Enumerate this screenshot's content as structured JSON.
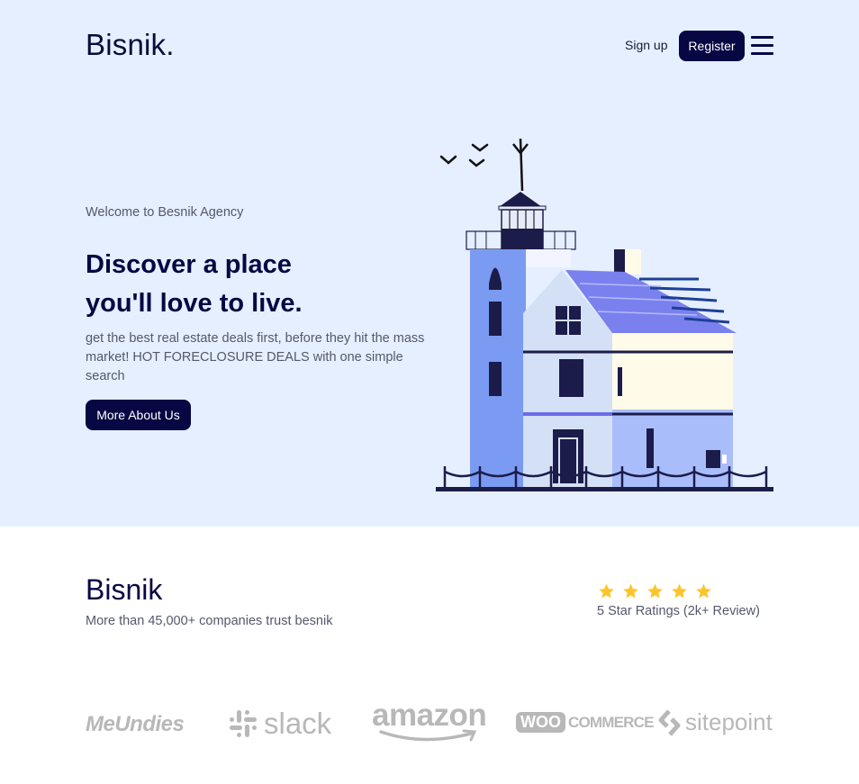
{
  "header": {
    "logo": "Bisnik.",
    "signup_label": "Sign up",
    "register_label": "Register"
  },
  "hero": {
    "welcome": "Welcome to Besnik Agency",
    "headline_line1": "Discover a place",
    "headline_line2": "you'll love to live.",
    "description": "get the best real estate deals first, before they hit the mass market! HOT FORECLOSURE DEALS with one simple search",
    "cta_label": "More About Us"
  },
  "trust": {
    "title": "Bisnik",
    "subtitle": "More than 45,000+ companies trust besnik",
    "stars": 5,
    "rating_text": "5 Star Ratings (2k+ Review)"
  },
  "partners": [
    {
      "name": "MeUndies",
      "icon": "meundies-logo"
    },
    {
      "name": "slack",
      "icon": "slack-logo"
    },
    {
      "name": "amazon",
      "icon": "amazon-logo"
    },
    {
      "name": "COMMERCE",
      "prefix": "WOO",
      "icon": "woocommerce-logo"
    },
    {
      "name": "sitepoint",
      "icon": "sitepoint-logo"
    }
  ],
  "colors": {
    "hero_bg": "#e5efff",
    "primary": "#070744",
    "star": "#fdc52c",
    "partner_gray": "#b8b8b8"
  }
}
